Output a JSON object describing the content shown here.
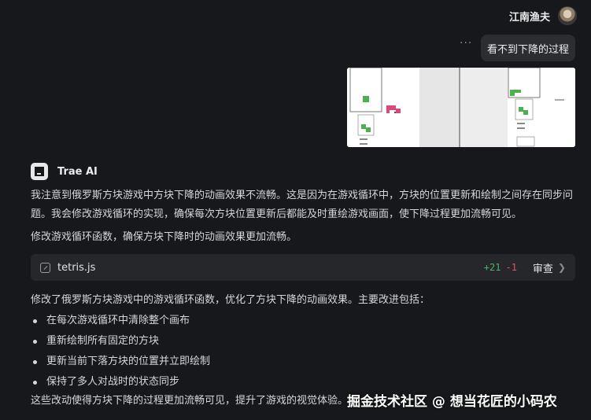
{
  "user": {
    "name": "江南渔夫",
    "message": "看不到下降的过程",
    "more": "···"
  },
  "assistant": {
    "name": "Trae AI",
    "intro": "我注意到俄罗斯方块游戏中方块下降的动画效果不流畅。这是因为在游戏循环中，方块的位置更新和绘制之间存在同步问题。我会修改游戏循环的实现，确保每次方块位置更新后都能及时重绘游戏画面，使下降过程更加流畅可见。",
    "action": "修改游戏循环函数，确保方块下降时的动画效果更加流畅。",
    "file": {
      "name": "tetris.js",
      "added": "+21",
      "removed": "-1",
      "review_label": "审查"
    },
    "summary": "修改了俄罗斯方块游戏中的游戏循环函数，优化了方块下降的动画效果。主要改进包括：",
    "bullets": [
      "在每次游戏循环中清除整个画布",
      "重新绘制所有固定的方块",
      "更新当前下落方块的位置并立即绘制",
      "保持了多人对战时的状态同步"
    ],
    "conclusion": "这些改动使得方块下降的过程更加流畅可见，提升了游戏的视觉体验。"
  },
  "watermark": "掘金技术社区 @ 想当花匠的小码农",
  "colors": {
    "background": "#17181b",
    "bubble": "#2c2d31",
    "card": "#26272b",
    "diff_add": "#4fb16a",
    "diff_del": "#e0565b"
  },
  "icons": {
    "file": "edit-file-icon",
    "review": "chevron-right-icon",
    "logo": "trae-logo-icon"
  }
}
